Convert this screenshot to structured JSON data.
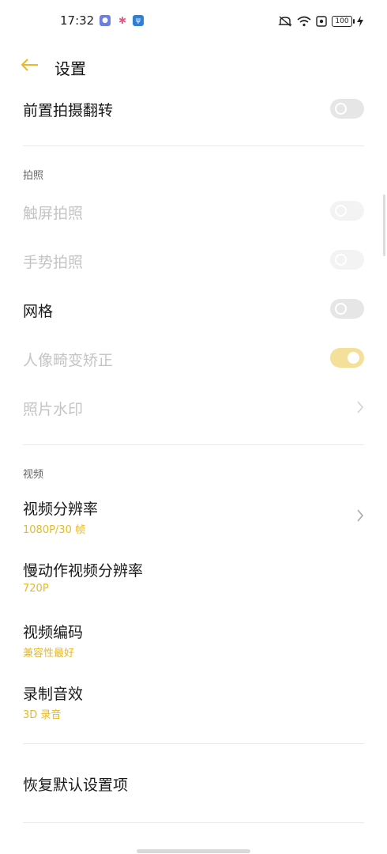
{
  "status_bar": {
    "time": "17:32",
    "notification_icons": [
      "assistant-app-icon",
      "photos-app-icon",
      "usb-icon"
    ],
    "right_icons": [
      "mute-icon",
      "wifi-icon",
      "screen-record-icon",
      "battery-icon",
      "charging-icon"
    ],
    "battery_level": "100"
  },
  "header": {
    "title": "设置",
    "accent_color": "#e8b923"
  },
  "rows": {
    "front_flip": {
      "label": "前置拍摄翻转",
      "toggle_on": false,
      "enabled": true
    },
    "touch_shoot": {
      "label": "触屏拍照",
      "toggle_on": false,
      "enabled": false
    },
    "gesture_shoot": {
      "label": "手势拍照",
      "toggle_on": false,
      "enabled": false
    },
    "grid": {
      "label": "网格",
      "toggle_on": false,
      "enabled": true
    },
    "portrait_correction": {
      "label": "人像畸变矫正",
      "toggle_on": true,
      "enabled": false
    },
    "watermark": {
      "label": "照片水印",
      "enabled": false
    },
    "video_resolution": {
      "label": "视频分辨率",
      "value": "1080P/30 帧"
    },
    "slowmo_resolution": {
      "label": "慢动作视频分辨率",
      "value": "720P"
    },
    "video_codec": {
      "label": "视频编码",
      "value": "兼容性最好"
    },
    "audio": {
      "label": "录制音效",
      "value": "3D 录音"
    },
    "reset": {
      "label": "恢复默认设置项"
    }
  },
  "sections": {
    "photo": "拍照",
    "video": "视频"
  }
}
